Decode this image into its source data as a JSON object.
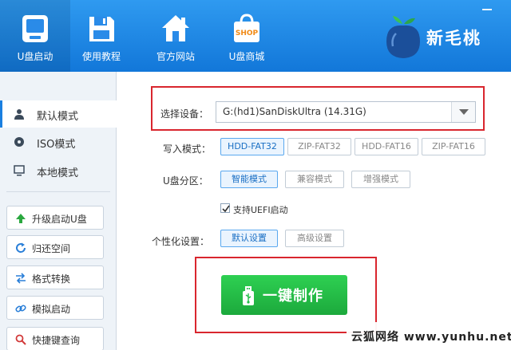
{
  "window": {
    "minimize_symbol": "—"
  },
  "toolbar": {
    "items": [
      {
        "label": "U盘启动",
        "icon": "usb-drive-icon",
        "active": true
      },
      {
        "label": "使用教程",
        "icon": "floppy-disk-icon",
        "active": false
      },
      {
        "label": "官方网站",
        "icon": "house-icon",
        "active": false
      },
      {
        "label": "U盘商城",
        "icon": "shop-bag-icon",
        "active": false,
        "badge": "SHOP"
      }
    ],
    "brand": {
      "name": "新毛桃",
      "logo": "peach-logo-icon"
    }
  },
  "sidebar": {
    "modes": [
      {
        "label": "默认模式",
        "icon": "user-icon",
        "active": true
      },
      {
        "label": "ISO模式",
        "icon": "disc-icon",
        "active": false
      },
      {
        "label": "本地模式",
        "icon": "monitor-icon",
        "active": false
      }
    ],
    "tools": [
      {
        "label": "升级启动U盘",
        "icon": "arrow-up-icon"
      },
      {
        "label": "归还空间",
        "icon": "refresh-icon"
      },
      {
        "label": "格式转换",
        "icon": "convert-icon"
      },
      {
        "label": "模拟启动",
        "icon": "link-icon"
      },
      {
        "label": "快捷键查询",
        "icon": "search-icon"
      }
    ]
  },
  "main": {
    "device": {
      "label": "选择设备：",
      "value": "G:(hd1)SanDiskUltra (14.31G)"
    },
    "write_mode": {
      "label": "写入模式：",
      "options": [
        "HDD-FAT32",
        "ZIP-FAT32",
        "HDD-FAT16",
        "ZIP-FAT16"
      ],
      "selected": "HDD-FAT32"
    },
    "partition": {
      "label": "U盘分区：",
      "options": [
        "智能模式",
        "兼容模式",
        "增强模式"
      ],
      "selected": "智能模式"
    },
    "uefi": {
      "label": "支持UEFI启动",
      "checked": true
    },
    "personalize": {
      "label": "个性化设置：",
      "options": [
        "默认设置",
        "高级设置"
      ],
      "selected": "默认设置"
    },
    "make_button": {
      "label": "一键制作",
      "icon": "usb-stick-icon"
    }
  },
  "watermark": {
    "text": "云狐网络 www.yunhu.net"
  },
  "colors": {
    "toolbar_blue": "#1a85e6",
    "highlight_red": "#d9262e",
    "action_green": "#22be48",
    "selected_blue": "#1a6fc4"
  }
}
